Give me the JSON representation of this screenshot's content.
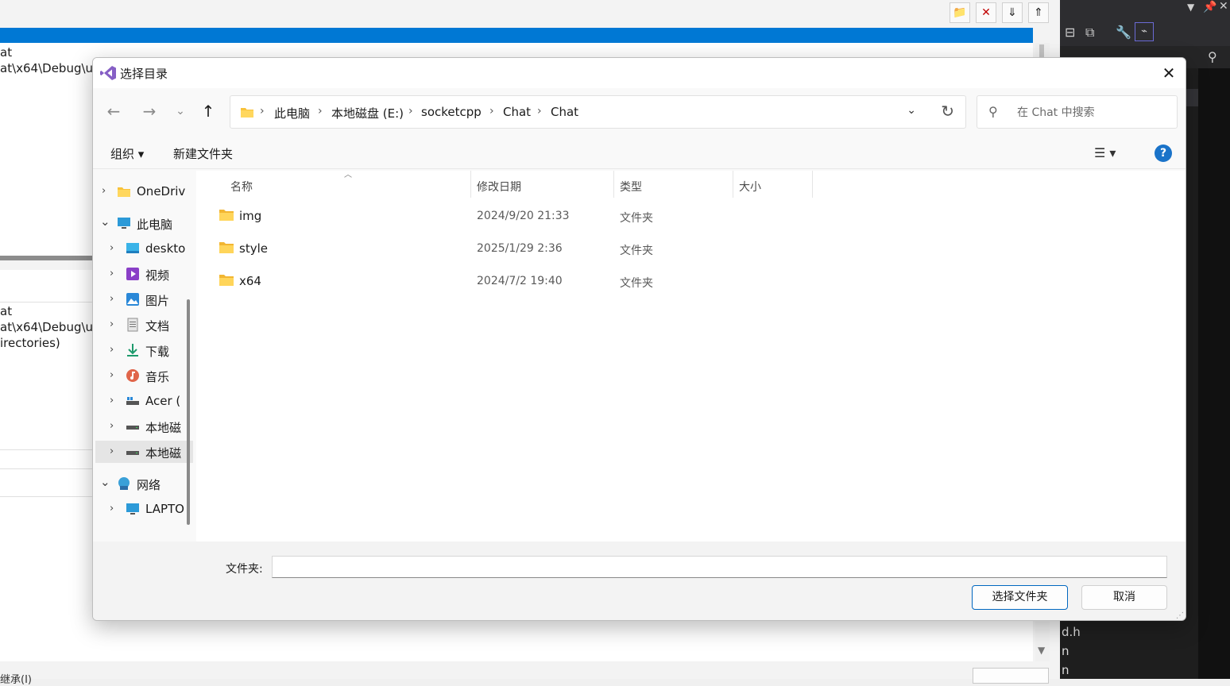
{
  "background": {
    "left_text_top": [
      "at",
      "at\\x64\\Debug\\u"
    ],
    "left_text_bottom": [
      "at",
      "at\\x64\\Debug\\u",
      "irectories)"
    ],
    "bottom_text": "继承(I)",
    "right_text": [
      "d.h",
      "n",
      "n"
    ]
  },
  "dialog": {
    "title": "选择目录",
    "close_glyph": "✕",
    "nav": {
      "back": "←",
      "forward": "→",
      "recent": "⌄",
      "up": "↑"
    },
    "breadcrumb": [
      "此电脑",
      "本地磁盘 (E:)",
      "socketcpp",
      "Chat",
      "Chat"
    ],
    "search_placeholder": "在 Chat 中搜索",
    "commands": {
      "organize": "组织 ▾",
      "new_folder": "新建文件夹",
      "view": "☰ ▾",
      "help": "?"
    },
    "tree": [
      {
        "label": "OneDriv",
        "expander": "›",
        "icon": "folder-icon"
      },
      {
        "label": "此电脑",
        "expander": "⌄",
        "icon": "computer-icon"
      },
      {
        "label": "deskto",
        "expander": "›",
        "icon": "desktop-icon"
      },
      {
        "label": "视频",
        "expander": "›",
        "icon": "video-icon"
      },
      {
        "label": "图片",
        "expander": "›",
        "icon": "picture-icon"
      },
      {
        "label": "文档",
        "expander": "›",
        "icon": "document-icon"
      },
      {
        "label": "下载",
        "expander": "›",
        "icon": "download-icon"
      },
      {
        "label": "音乐",
        "expander": "›",
        "icon": "music-icon"
      },
      {
        "label": "Acer (",
        "expander": "›",
        "icon": "drive-icon"
      },
      {
        "label": "本地磁",
        "expander": "›",
        "icon": "drive-icon"
      },
      {
        "label": "本地磁",
        "expander": "›",
        "icon": "drive-icon"
      },
      {
        "label": "网络",
        "expander": "⌄",
        "icon": "network-icon"
      },
      {
        "label": "LAPTO",
        "expander": "›",
        "icon": "computer-icon"
      }
    ],
    "columns": {
      "name": "名称",
      "modified": "修改日期",
      "type": "类型",
      "size": "大小"
    },
    "files": [
      {
        "name": "img",
        "modified": "2024/9/20 21:33",
        "type": "文件夹"
      },
      {
        "name": "style",
        "modified": "2025/1/29 2:36",
        "type": "文件夹"
      },
      {
        "name": "x64",
        "modified": "2024/7/2 19:40",
        "type": "文件夹"
      }
    ],
    "folder_label": "文件夹:",
    "folder_value": "",
    "select_button": "选择文件夹",
    "cancel_button": "取消"
  }
}
